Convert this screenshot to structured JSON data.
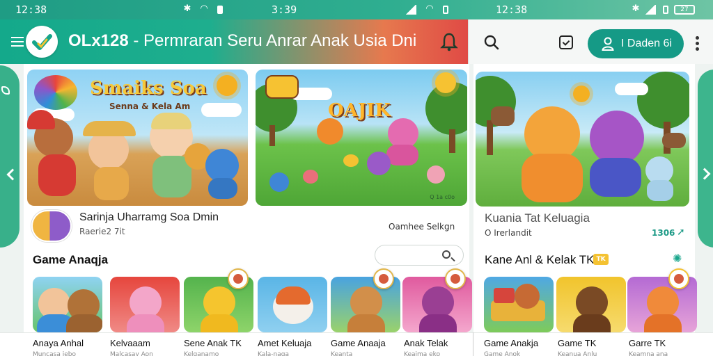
{
  "status_bar": {
    "time_left": "12:38",
    "time_center": "3:39",
    "time_right": "12:38",
    "battery_right": "27"
  },
  "app_bar": {
    "brand": "OLx128",
    "title_rest": " - Permraran Seru Anrar Anak Usia Dni",
    "sign_in_label": "I Daden 6i",
    "accent": "#1a9e87",
    "alert": "#e04a45"
  },
  "banners": [
    {
      "title": "Smaiks Soa",
      "subtitle": "Senna & Kela Am"
    },
    {
      "title": "OAJIK",
      "watermark": "Q 1a c0o"
    },
    {
      "title": ""
    }
  ],
  "feature_left": {
    "name": "Sarinja Uharramg Soa Dmin",
    "meta": "Raerie2 7it",
    "right_label": "Oamhee Selkgn"
  },
  "feature_right": {
    "name": "Kuania Tat Keluagia",
    "meta": "O Irerlandit",
    "count": "1306"
  },
  "sections": {
    "left_title": "Game Anaqja",
    "right_title": "Kane Anl & Kelak TK",
    "right_badge": "TK"
  },
  "tiles": [
    {
      "label": "Anaya Anhal",
      "sub": "Muncasa jebo"
    },
    {
      "label": "Kelvaaam",
      "sub": "Malcasay Aon"
    },
    {
      "label": "Sene Anak TK",
      "sub": "Kelganamo"
    },
    {
      "label": "Amet Keluaja",
      "sub": "Kala-naga"
    },
    {
      "label": "Game Anaaja",
      "sub": "Keanta"
    },
    {
      "label": "Anak Telak",
      "sub": "Keaima eko"
    },
    {
      "label": "Game Anakja",
      "sub": "Game Anok"
    },
    {
      "label": "Game TK",
      "sub": "Keanua Anlu"
    },
    {
      "label": "Garre TK",
      "sub": "Keamna ana"
    }
  ]
}
